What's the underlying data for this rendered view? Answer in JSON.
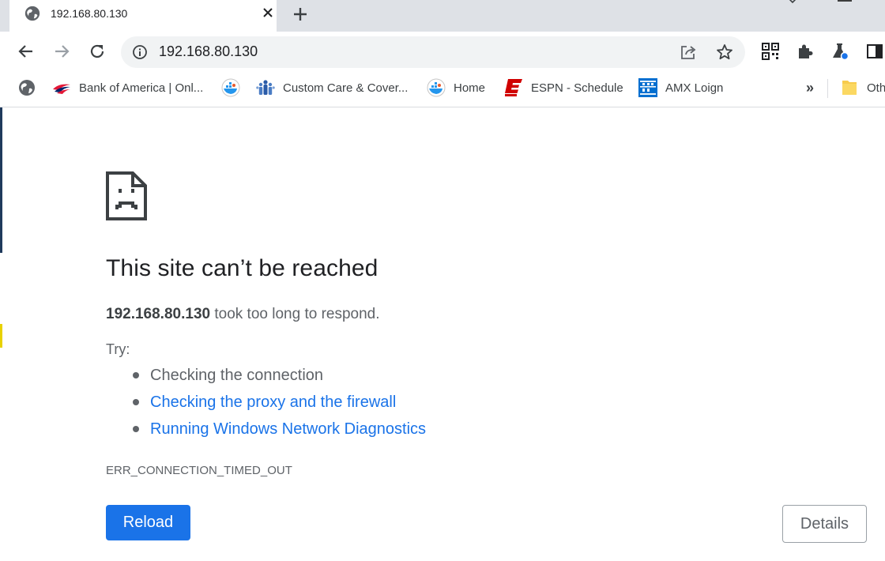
{
  "tab": {
    "title": "192.168.80.130",
    "favicon": "globe-icon",
    "close": "close-icon"
  },
  "toolbar": {
    "url": "192.168.80.130",
    "back": "arrow-left-icon",
    "forward": "arrow-right-icon",
    "reload": "reload-icon",
    "extensions": [
      "qr-code-icon",
      "puzzle-icon",
      "flask-icon",
      "side-panel-icon"
    ]
  },
  "bookmarks": {
    "items": [
      {
        "label": "",
        "icon": "globe-icon"
      },
      {
        "label": "Bank of America | Onl...",
        "icon": "bank-flag-icon"
      },
      {
        "label": "",
        "icon": "docker-icon"
      },
      {
        "label": "Custom Care & Cover...",
        "icon": "people-icon"
      },
      {
        "label": "Home",
        "icon": "docker-icon"
      },
      {
        "label": "ESPN - Schedule",
        "icon": "espn-icon"
      },
      {
        "label": "AMX Loign",
        "icon": "amex-icon"
      }
    ],
    "overflow": "»",
    "other": "Oth"
  },
  "error": {
    "heading": "This site can’t be reached",
    "host": "192.168.80.130",
    "message": " took too long to respond.",
    "try_label": "Try:",
    "suggestions": [
      {
        "text": "Checking the connection",
        "link": false
      },
      {
        "text": "Checking the proxy and the firewall",
        "link": true
      },
      {
        "text": "Running Windows Network Diagnostics",
        "link": true
      }
    ],
    "code": "ERR_CONNECTION_TIMED_OUT",
    "reload_label": "Reload",
    "details_label": "Details"
  },
  "colors": {
    "accent": "#1a73e8",
    "text_secondary": "#5f6368",
    "tabstrip": "#dee1e6"
  }
}
